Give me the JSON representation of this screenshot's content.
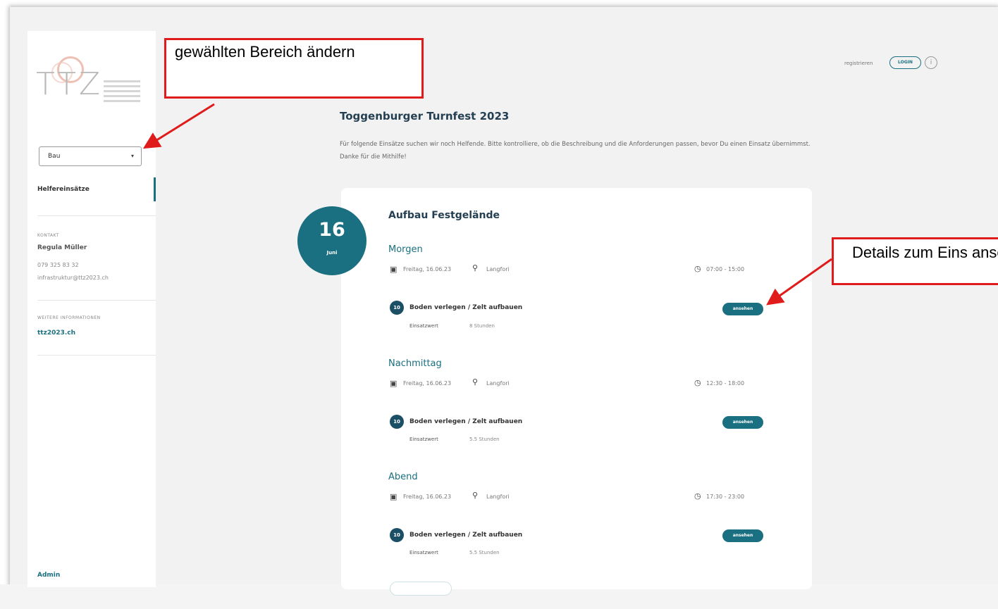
{
  "sidebar": {
    "logo_text": "TTZ",
    "area_select": {
      "value": "Bau",
      "caret": "▾"
    },
    "nav": {
      "helfereinsaetze": "Helfereinsätze"
    },
    "contact": {
      "heading": "KONTAKT",
      "name": "Regula Müller",
      "phone": "079 325 83 32",
      "email": "infrastruktur@ttz2023.ch"
    },
    "more_info": {
      "heading": "WEITERE INFORMATIONEN",
      "link": "ttz2023.ch"
    },
    "admin": "Admin"
  },
  "header": {
    "register": "registrieren",
    "login": "LOGIN",
    "info_icon": "info-icon",
    "info_glyph": "i"
  },
  "main": {
    "title": "Toggenburger Turnfest 2023",
    "description": "Für folgende Einsätze suchen wir noch Helfende. Bitte kontrolliere, ob die Beschreibung und die Anforderungen passen, bevor Du einen Einsatz übernimmst. Danke für die Mithilfe!",
    "date_badge": {
      "day": "16",
      "month": "Juni"
    },
    "card_title": "Aufbau Festgelände",
    "slots": [
      {
        "title": "Morgen",
        "date": "Freitag, 16.06.23",
        "location": "Langfori",
        "time": "07:00 - 15:00",
        "task_count": "10",
        "task": "Boden verlegen / Zelt aufbauen",
        "value_label": "Einsatzwert",
        "value": "8 Stunden",
        "button": "ansehen"
      },
      {
        "title": "Nachmittag",
        "date": "Freitag, 16.06.23",
        "location": "Langfori",
        "time": "12:30 - 18:00",
        "task_count": "10",
        "task": "Boden verlegen / Zelt aufbauen",
        "value_label": "Einsatzwert",
        "value": "5.5 Stunden",
        "button": "ansehen"
      },
      {
        "title": "Abend",
        "date": "Freitag, 16.06.23",
        "location": "Langfori",
        "time": "17:30 - 23:00",
        "task_count": "10",
        "task": "Boden verlegen / Zelt aufbauen",
        "value_label": "Einsatzwert",
        "value": "5.5 Stunden",
        "button": "ansehen"
      }
    ]
  },
  "annotations": {
    "callout_area": "gewählten Bereich ändern",
    "callout_details": "Details zum Eins ansehen"
  },
  "icons": {
    "calendar": "calendar-icon",
    "location": "location-pin-icon",
    "clock": "clock-icon",
    "caret": "chevron-down-icon"
  },
  "colors": {
    "accent": "#1a6f80",
    "annotation": "#e01b1b",
    "title": "#243f52"
  }
}
